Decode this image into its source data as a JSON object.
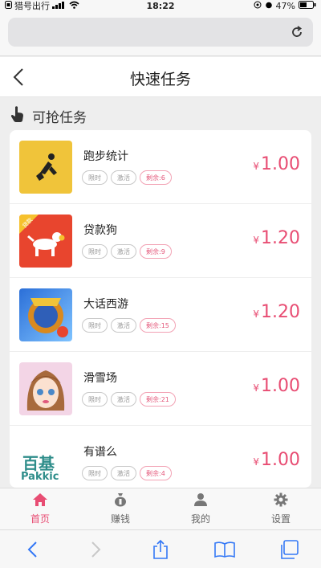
{
  "status_bar": {
    "carrier": "猎号出行",
    "time": "18:22",
    "battery": "47%"
  },
  "nav": {
    "title": "快速任务"
  },
  "section": {
    "title": "可抢任务"
  },
  "tasks": [
    {
      "name": "跑步统计",
      "tags": [
        "限时",
        "激活",
        "剩余:6"
      ],
      "currency": "¥",
      "price": "1.00"
    },
    {
      "name": "贷款狗",
      "tags": [
        "限时",
        "激活",
        "剩余:9"
      ],
      "currency": "¥",
      "price": "1.20"
    },
    {
      "name": "大话西游",
      "tags": [
        "限时",
        "激活",
        "剩余:15"
      ],
      "currency": "¥",
      "price": "1.20"
    },
    {
      "name": "滑雪场",
      "tags": [
        "限时",
        "激活",
        "剩余:21"
      ],
      "currency": "¥",
      "price": "1.00"
    },
    {
      "name": "有谱么",
      "tags": [
        "限时",
        "激活",
        "剩余:4"
      ],
      "currency": "¥",
      "price": "1.00"
    }
  ],
  "thumb_text": {
    "loan_badge": "贷款",
    "pakkic_top": "百基",
    "pakkic_bottom": "Pakkic"
  },
  "tabbar": [
    {
      "label": "首页",
      "icon": "home-icon",
      "active": true
    },
    {
      "label": "赚钱",
      "icon": "money-bag-icon",
      "active": false
    },
    {
      "label": "我的",
      "icon": "user-icon",
      "active": false
    },
    {
      "label": "设置",
      "icon": "gear-icon",
      "active": false
    }
  ],
  "colors": {
    "accent": "#e84d73",
    "ios_blue": "#3478f6"
  }
}
